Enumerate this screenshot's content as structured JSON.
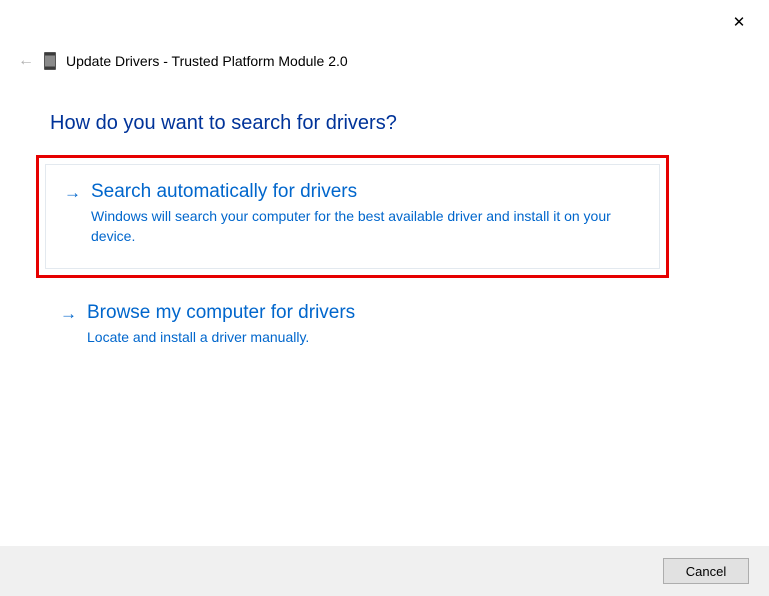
{
  "header": {
    "title": "Update Drivers - Trusted Platform Module 2.0"
  },
  "heading": "How do you want to search for drivers?",
  "options": [
    {
      "title": "Search automatically for drivers",
      "description": "Windows will search your computer for the best available driver and install it on your device."
    },
    {
      "title": "Browse my computer for drivers",
      "description": "Locate and install a driver manually."
    }
  ],
  "footer": {
    "cancel_label": "Cancel"
  }
}
